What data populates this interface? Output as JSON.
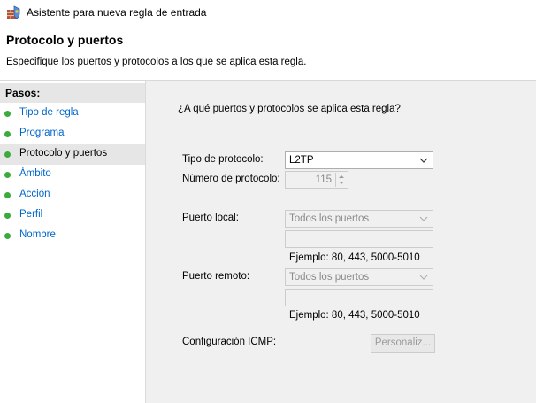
{
  "window": {
    "title": "Asistente para nueva regla de entrada"
  },
  "header": {
    "title": "Protocolo y puertos",
    "description": "Especifique los puertos y protocolos a los que se aplica esta regla."
  },
  "sidebar": {
    "label": "Pasos:",
    "steps": [
      {
        "label": "Tipo de regla"
      },
      {
        "label": "Programa"
      },
      {
        "label": "Protocolo y puertos"
      },
      {
        "label": "Ámbito"
      },
      {
        "label": "Acción"
      },
      {
        "label": "Perfil"
      },
      {
        "label": "Nombre"
      }
    ]
  },
  "main": {
    "question": "¿A qué puertos y protocolos se aplica esta regla?",
    "protocol_type": {
      "label": "Tipo de protocolo:",
      "value": "L2TP"
    },
    "protocol_number": {
      "label": "Número de protocolo:",
      "value": "115"
    },
    "local_port": {
      "label": "Puerto local:",
      "value": "Todos los puertos",
      "example": "Ejemplo: 80, 443, 5000-5010"
    },
    "remote_port": {
      "label": "Puerto remoto:",
      "value": "Todos los puertos",
      "example": "Ejemplo: 80, 443, 5000-5010"
    },
    "icmp": {
      "label": "Configuración ICMP:",
      "button": "Personaliz..."
    }
  },
  "colors": {
    "accent_link": "#0066cc",
    "step_dot": "#3bab3b",
    "panel_bg": "#f0f0f0"
  }
}
